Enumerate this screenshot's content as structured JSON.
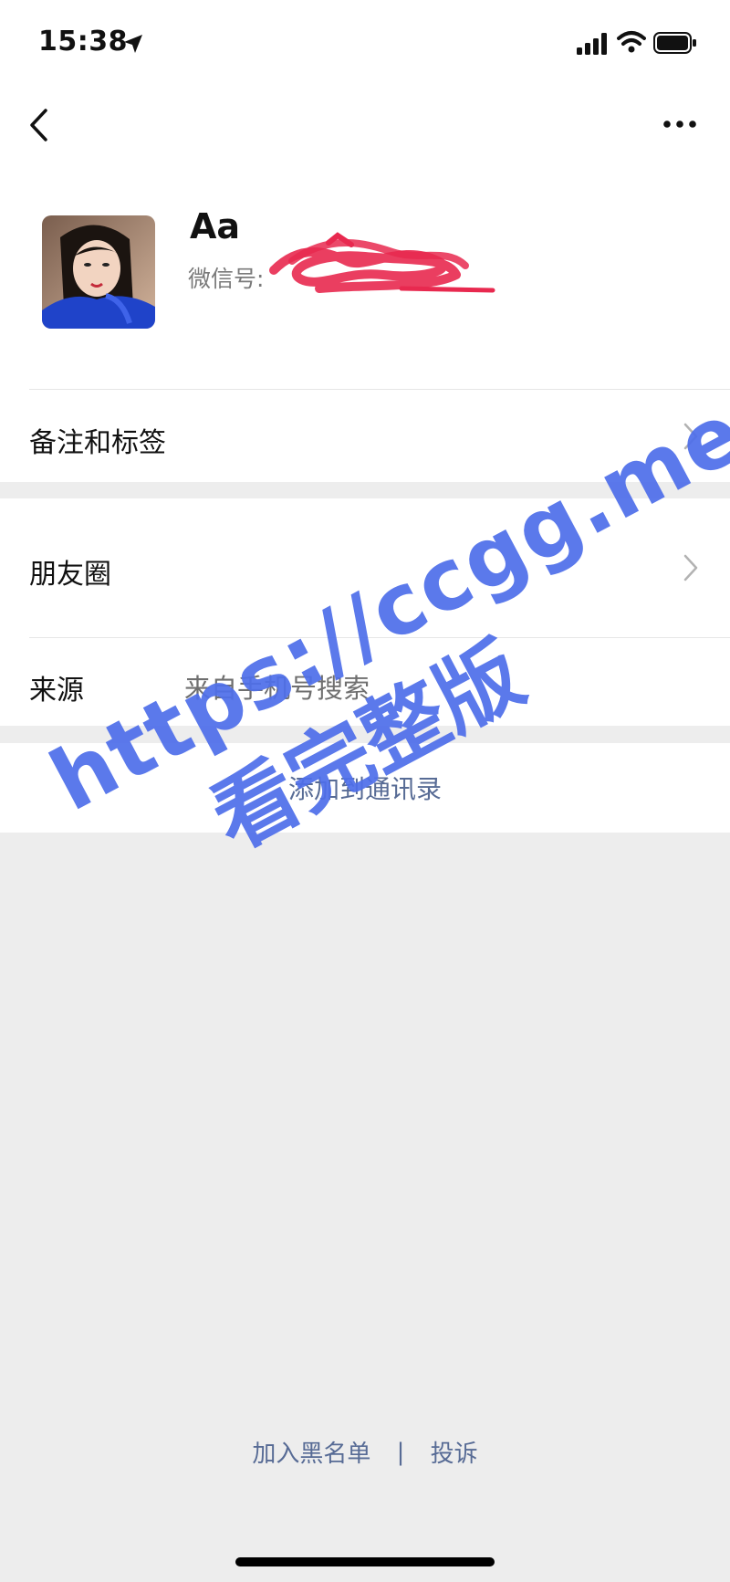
{
  "status_bar": {
    "time": "15:38"
  },
  "profile": {
    "name": "Aa",
    "wechat_id_label": "微信号:"
  },
  "rows": {
    "remark_label": "备注和标签",
    "moments_label": "朋友圈",
    "source_label": "来源",
    "source_value": "来自手机号搜索"
  },
  "actions": {
    "add_contact": "添加到通讯录"
  },
  "footer": {
    "blacklist": "加入黑名单",
    "separator": "|",
    "report": "投诉"
  },
  "watermark": {
    "line1": "https://ccgg.me",
    "line2": "看完整版"
  },
  "colors": {
    "link": "#576b95",
    "watermark": "#4f6fea",
    "scribble": "#e8294f"
  }
}
